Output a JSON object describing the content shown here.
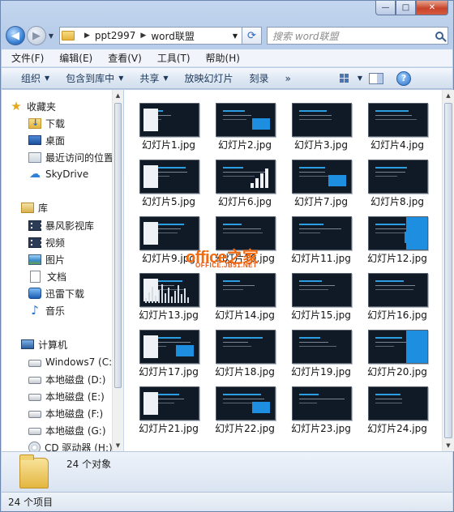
{
  "window": {
    "minimize": "—",
    "maximize": "□",
    "close": "✕"
  },
  "address": {
    "segments": [
      "ppt2997",
      "word联盟"
    ]
  },
  "search": {
    "placeholder": "搜索 word联盟"
  },
  "menu": [
    "文件(F)",
    "编辑(E)",
    "查看(V)",
    "工具(T)",
    "帮助(H)"
  ],
  "toolbar": {
    "organize": "组织",
    "include": "包含到库中",
    "share": "共享",
    "slideshow": "放映幻灯片",
    "burn": "刻录",
    "more": "»"
  },
  "sidebar": {
    "favorites": "收藏夹",
    "downloads": "下载",
    "desktop": "桌面",
    "recent": "最近访问的位置",
    "skydrive": "SkyDrive",
    "libraries": "库",
    "baofeng": "暴风影视库",
    "videos": "视频",
    "pictures": "图片",
    "documents": "文档",
    "thunder": "迅雷下载",
    "music": "音乐",
    "computer": "计算机",
    "c": "Windows7 (C:)",
    "d": "本地磁盘 (D:)",
    "e": "本地磁盘 (E:)",
    "f": "本地磁盘 (F:)",
    "g": "本地磁盘 (G:)",
    "h": "CD 驱动器 (H:)"
  },
  "files": [
    "幻灯片1.jpg",
    "幻灯片2.jpg",
    "幻灯片3.jpg",
    "幻灯片4.jpg",
    "幻灯片5.jpg",
    "幻灯片6.jpg",
    "幻灯片7.jpg",
    "幻灯片8.jpg",
    "幻灯片9.jpg",
    "幻灯片10.jpg",
    "幻灯片11.jpg",
    "幻灯片12.jpg",
    "幻灯片13.jpg",
    "幻灯片14.jpg",
    "幻灯片15.jpg",
    "幻灯片16.jpg",
    "幻灯片17.jpg",
    "幻灯片18.jpg",
    "幻灯片19.jpg",
    "幻灯片20.jpg",
    "幻灯片21.jpg",
    "幻灯片22.jpg",
    "幻灯片23.jpg",
    "幻灯片24.jpg"
  ],
  "watermark": {
    "main": "office之家",
    "sub": "OFFICE.JB51.NET"
  },
  "details": {
    "count": "24 个对象"
  },
  "status": {
    "items": "24 个项目"
  }
}
